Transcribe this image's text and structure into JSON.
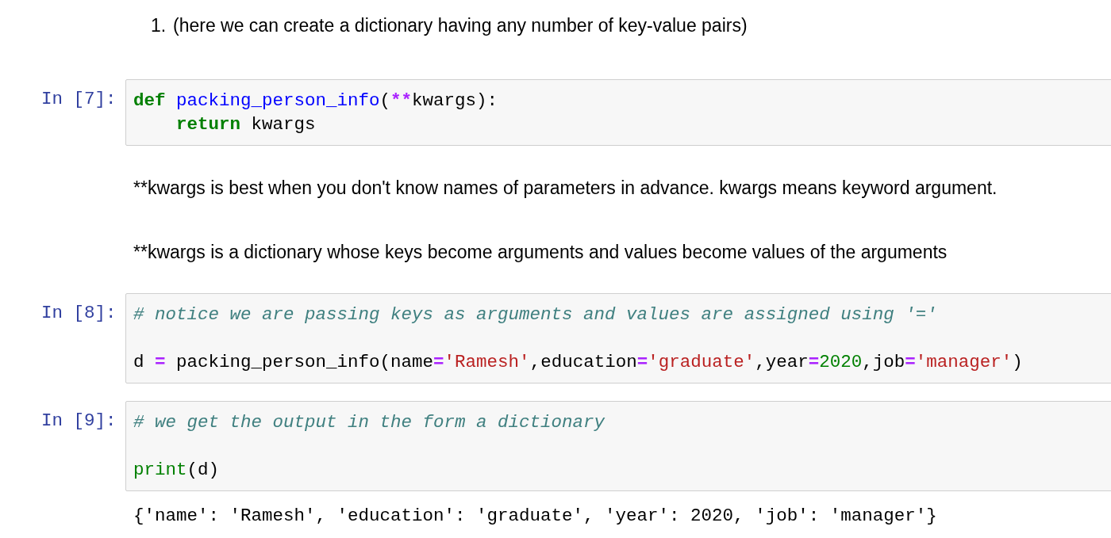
{
  "cells": [
    {
      "kind": "markdown_list",
      "number": "1.",
      "text": "(here we can create a dictionary having any number of key-value pairs)"
    },
    {
      "kind": "code",
      "prompt": "In [7]:",
      "lines": [
        {
          "gap_before": false,
          "indented": false,
          "tokens": [
            {
              "kind": "keyword",
              "text": "def "
            },
            {
              "kind": "defname",
              "text": "packing_person_info"
            },
            {
              "kind": "plain",
              "text": "("
            },
            {
              "kind": "operator",
              "text": "**"
            },
            {
              "kind": "plain",
              "text": "kwargs):"
            }
          ]
        },
        {
          "gap_before": false,
          "indented": true,
          "tokens": [
            {
              "kind": "keyword",
              "text": "return"
            },
            {
              "kind": "plain",
              "text": " kwargs"
            }
          ]
        }
      ]
    },
    {
      "kind": "markdown",
      "text": "**kwargs is best when you don't know names of parameters in advance. kwargs means keyword argument."
    },
    {
      "kind": "markdown",
      "text": "**kwargs is a dictionary whose keys become arguments and values become values of the arguments"
    },
    {
      "kind": "code",
      "prompt": "In [8]:",
      "lines": [
        {
          "gap_before": false,
          "indented": false,
          "tokens": [
            {
              "kind": "comment",
              "text": "# notice we are passing keys as arguments and values are assigned using '='"
            }
          ]
        },
        {
          "gap_before": true,
          "indented": false,
          "tokens": [
            {
              "kind": "plain",
              "text": "d "
            },
            {
              "kind": "operator",
              "text": "="
            },
            {
              "kind": "plain",
              "text": " packing_person_info(name"
            },
            {
              "kind": "operator",
              "text": "="
            },
            {
              "kind": "string",
              "text": "'Ramesh'"
            },
            {
              "kind": "plain",
              "text": ",education"
            },
            {
              "kind": "operator",
              "text": "="
            },
            {
              "kind": "string",
              "text": "'graduate'"
            },
            {
              "kind": "plain",
              "text": ",year"
            },
            {
              "kind": "operator",
              "text": "="
            },
            {
              "kind": "number",
              "text": "2020"
            },
            {
              "kind": "plain",
              "text": ",job"
            },
            {
              "kind": "operator",
              "text": "="
            },
            {
              "kind": "string",
              "text": "'manager'"
            },
            {
              "kind": "plain",
              "text": ")"
            }
          ]
        }
      ]
    },
    {
      "kind": "code",
      "prompt": "In [9]:",
      "lines": [
        {
          "gap_before": false,
          "indented": false,
          "tokens": [
            {
              "kind": "comment",
              "text": "# we get the output in the form a dictionary"
            }
          ]
        },
        {
          "gap_before": true,
          "indented": false,
          "tokens": [
            {
              "kind": "builtin",
              "text": "print"
            },
            {
              "kind": "plain",
              "text": "(d)"
            }
          ]
        }
      ]
    },
    {
      "kind": "output",
      "text": "{'name': 'Ramesh', 'education': 'graduate', 'year': 2020, 'job': 'manager'}"
    }
  ]
}
